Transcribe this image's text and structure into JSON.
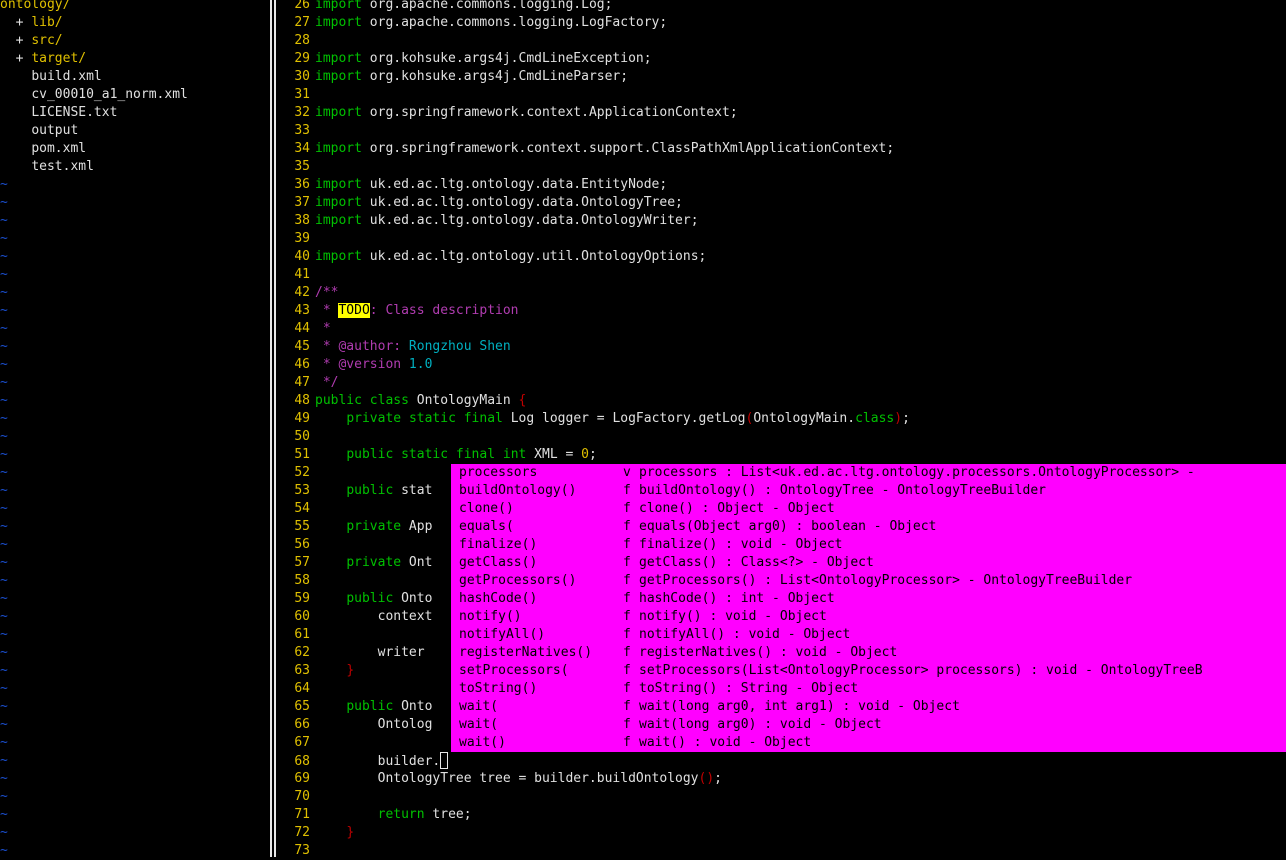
{
  "tree": {
    "root": "ontology/",
    "entries": [
      {
        "marker": "+",
        "name": "lib/",
        "kind": "dir"
      },
      {
        "marker": "+",
        "name": "src/",
        "kind": "dir"
      },
      {
        "marker": "+",
        "name": "target/",
        "kind": "dir"
      },
      {
        "marker": "",
        "name": "build.xml",
        "kind": "file"
      },
      {
        "marker": "",
        "name": "cv_00010_a1_norm.xml",
        "kind": "file"
      },
      {
        "marker": "",
        "name": "LICENSE.txt",
        "kind": "file"
      },
      {
        "marker": "",
        "name": "output",
        "kind": "file"
      },
      {
        "marker": "",
        "name": "pom.xml",
        "kind": "file"
      },
      {
        "marker": "",
        "name": "test.xml",
        "kind": "file"
      }
    ],
    "filler": "~"
  },
  "code": {
    "lines": [
      {
        "n": "26",
        "t": "import org.apache.commons.logging.Log;"
      },
      {
        "n": "27",
        "t": "import org.apache.commons.logging.LogFactory;"
      },
      {
        "n": "28",
        "t": ""
      },
      {
        "n": "29",
        "t": "import org.kohsuke.args4j.CmdLineException;"
      },
      {
        "n": "30",
        "t": "import org.kohsuke.args4j.CmdLineParser;"
      },
      {
        "n": "31",
        "t": ""
      },
      {
        "n": "32",
        "t": "import org.springframework.context.ApplicationContext;"
      },
      {
        "n": "33",
        "t": ""
      },
      {
        "n": "34",
        "t": "import org.springframework.context.support.ClassPathXmlApplicationContext;"
      },
      {
        "n": "35",
        "t": ""
      },
      {
        "n": "36",
        "t": "import uk.ed.ac.ltg.ontology.data.EntityNode;"
      },
      {
        "n": "37",
        "t": "import uk.ed.ac.ltg.ontology.data.OntologyTree;"
      },
      {
        "n": "38",
        "t": "import uk.ed.ac.ltg.ontology.data.OntologyWriter;"
      },
      {
        "n": "39",
        "t": ""
      },
      {
        "n": "40",
        "t": "import uk.ed.ac.ltg.ontology.util.OntologyOptions;"
      },
      {
        "n": "41",
        "t": ""
      },
      {
        "n": "42",
        "t": "/**"
      },
      {
        "n": "43",
        "t": " * TODO: Class description"
      },
      {
        "n": "44",
        "t": " *"
      },
      {
        "n": "45",
        "t": " * @author: Rongzhou Shen"
      },
      {
        "n": "46",
        "t": " * @version 1.0"
      },
      {
        "n": "47",
        "t": " */"
      },
      {
        "n": "48",
        "t": "public class OntologyMain {"
      },
      {
        "n": "49",
        "t": "    private static final Log logger = LogFactory.getLog(OntologyMain.class);"
      },
      {
        "n": "50",
        "t": ""
      },
      {
        "n": "51",
        "t": "    public static final int XML = 0;"
      },
      {
        "n": "52",
        "t": ""
      },
      {
        "n": "53",
        "t": "    public stat"
      },
      {
        "n": "54",
        "t": ""
      },
      {
        "n": "55",
        "t": "    private App"
      },
      {
        "n": "56",
        "t": ""
      },
      {
        "n": "57",
        "t": "    private Ont"
      },
      {
        "n": "58",
        "t": ""
      },
      {
        "n": "59",
        "t": "    public Onto"
      },
      {
        "n": "60",
        "t": "        context"
      },
      {
        "n": "61",
        "t": ""
      },
      {
        "n": "62",
        "t": "        writer"
      },
      {
        "n": "63",
        "t": "    }"
      },
      {
        "n": "64",
        "t": ""
      },
      {
        "n": "65",
        "t": "    public Onto"
      },
      {
        "n": "66",
        "t": "        Ontolog"
      },
      {
        "n": "67",
        "t": ""
      },
      {
        "n": "68",
        "t": "        builder."
      },
      {
        "n": "69",
        "t": "        OntologyTree tree = builder.buildOntology();"
      },
      {
        "n": "70",
        "t": ""
      },
      {
        "n": "71",
        "t": "        return tree;"
      },
      {
        "n": "72",
        "t": "    }"
      },
      {
        "n": "73",
        "t": ""
      }
    ]
  },
  "completion": {
    "items": [
      {
        "word": "processors",
        "kind": "v",
        "menu": "processors : List<uk.ed.ac.ltg.ontology.processors.OntologyProcessor> -"
      },
      {
        "word": "buildOntology()",
        "kind": "f",
        "menu": "buildOntology() : OntologyTree - OntologyTreeBuilder"
      },
      {
        "word": "clone()",
        "kind": "f",
        "menu": "clone() : Object - Object"
      },
      {
        "word": "equals(",
        "kind": "f",
        "menu": "equals(Object arg0) : boolean - Object"
      },
      {
        "word": "finalize()",
        "kind": "f",
        "menu": "finalize() : void - Object"
      },
      {
        "word": "getClass()",
        "kind": "f",
        "menu": "getClass() : Class<?> - Object"
      },
      {
        "word": "getProcessors()",
        "kind": "f",
        "menu": "getProcessors() : List<OntologyProcessor> - OntologyTreeBuilder"
      },
      {
        "word": "hashCode()",
        "kind": "f",
        "menu": "hashCode() : int - Object"
      },
      {
        "word": "notify()",
        "kind": "f",
        "menu": "notify() : void - Object"
      },
      {
        "word": "notifyAll()",
        "kind": "f",
        "menu": "notifyAll() : void - Object"
      },
      {
        "word": "registerNatives()",
        "kind": "f",
        "menu": "registerNatives() : void - Object"
      },
      {
        "word": "setProcessors(",
        "kind": "f",
        "menu": "setProcessors(List<OntologyProcessor> processors) : void - OntologyTreeB"
      },
      {
        "word": "toString()",
        "kind": "f",
        "menu": "toString() : String - Object"
      },
      {
        "word": "wait(",
        "kind": "f",
        "menu": "wait(long arg0, int arg1) : void - Object"
      },
      {
        "word": "wait(",
        "kind": "f",
        "menu": "wait(long arg0) : void - Object"
      },
      {
        "word": "wait()",
        "kind": "f",
        "menu": "wait() : void - Object"
      }
    ]
  },
  "colors": {
    "background": "#000000",
    "line_number": "#e0c000",
    "keyword": "#00c000",
    "comment": "#b03cb0",
    "popup": "#ff00ff",
    "tilde": "#1a4fd0",
    "todo_highlight": "#ffff00"
  }
}
